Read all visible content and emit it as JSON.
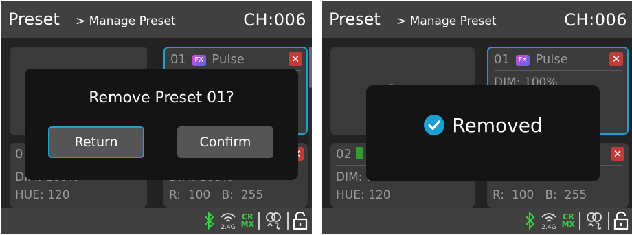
{
  "left_screen": {
    "header": {
      "title": "Preset",
      "breadcrumb": "> Manage Preset",
      "channel": "CH:006"
    },
    "card_selected": {
      "number": "01",
      "fx_badge": "FX",
      "name": "Pulse",
      "delete": "✕"
    },
    "card_bottom_left": {
      "number": "0",
      "line1": "DIM: 100%",
      "line2": "HUE: 120"
    },
    "card_bottom_right": {
      "delete": "✕",
      "line1": "DIM: 100%",
      "line2": "R:  100   B:  255"
    },
    "dialog": {
      "question": "Remove Preset 01?",
      "return_label": "Return",
      "confirm_label": "Confirm"
    }
  },
  "right_screen": {
    "header": {
      "title": "Preset",
      "breadcrumb": "> Manage Preset",
      "channel": "CH:006"
    },
    "card_top_left": {
      "partial_text": "Ret"
    },
    "card_selected": {
      "number": "01",
      "fx_badge": "FX",
      "name": "Pulse",
      "delete": "✕",
      "line1": "DIM: 100%"
    },
    "card_bottom_left": {
      "number": "02",
      "line1": "DIM: 100%",
      "line2": "HUE: 120"
    },
    "card_bottom_right": {
      "delete": "✕",
      "line1": "DIM: 100%",
      "line2": "R:  100   B:  255"
    },
    "toast": {
      "message": "Removed"
    }
  },
  "status_bar": {
    "wireless_label": "2.4G",
    "crmx_top": "CR",
    "crmx_bottom": "MX"
  },
  "colors": {
    "accent": "#1e9fd2",
    "delete": "#c23b3b",
    "status_green": "#3bd04a"
  },
  "icons": [
    "bluetooth-icon",
    "wireless-2.4g-icon",
    "crmx-icon",
    "dmx-link-icon",
    "lock-icon",
    "check-circle-icon",
    "fx-badge-icon"
  ]
}
